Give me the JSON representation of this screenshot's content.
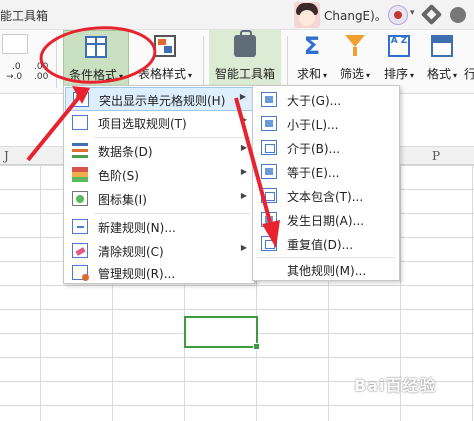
{
  "titlebar": {
    "title": "能工具箱",
    "user_name": "ChangE)。"
  },
  "ribbon": {
    "number_format": {
      "inc": ".0",
      "inc2": ".00",
      "dec": "→.0",
      "dec2": ".00"
    },
    "tools": {
      "conditional_format": "条件格式",
      "table_style": "表格样式",
      "smart_toolbox": "智能工具箱",
      "sum": "求和",
      "filter": "筛选",
      "sort": "排序",
      "format": "格式",
      "more": "行"
    },
    "sort_icon_text": "A Z"
  },
  "sheet": {
    "col_headers": {
      "j": "J",
      "p": "P"
    }
  },
  "menu_main": {
    "items": [
      {
        "label": "突出显示单元格规则(H)",
        "icon": "highlight-rules-icon",
        "submenu": true
      },
      {
        "label": "项目选取规则(T)",
        "icon": "top-bottom-rules-icon",
        "submenu": true
      },
      {
        "label": "数据条(D)",
        "icon": "data-bars-icon",
        "submenu": true
      },
      {
        "label": "色阶(S)",
        "icon": "color-scales-icon",
        "submenu": true
      },
      {
        "label": "图标集(I)",
        "icon": "icon-sets-icon",
        "submenu": true
      },
      {
        "label": "新建规则(N)...",
        "icon": "new-rule-icon",
        "submenu": false
      },
      {
        "label": "清除规则(C)",
        "icon": "clear-rules-icon",
        "submenu": true
      },
      {
        "label": "管理规则(R)...",
        "icon": "manage-rules-icon",
        "submenu": false
      }
    ],
    "submenu_arrow": "▶"
  },
  "menu_highlight": {
    "items": [
      {
        "label": "大于(G)..."
      },
      {
        "label": "小于(L)..."
      },
      {
        "label": "介于(B)..."
      },
      {
        "label": "等于(E)..."
      },
      {
        "label": "文本包含(T)..."
      },
      {
        "label": "发生日期(A)..."
      },
      {
        "label": "重复值(D)..."
      },
      {
        "label": "其他规则(M)..."
      }
    ]
  },
  "watermark": "Bai百经验",
  "colors": {
    "annotation_red": "#e8232f",
    "selection_green": "#3f9b3f",
    "active_tool": "#c9e1c0",
    "menu_highlight": "#ddeefc"
  }
}
